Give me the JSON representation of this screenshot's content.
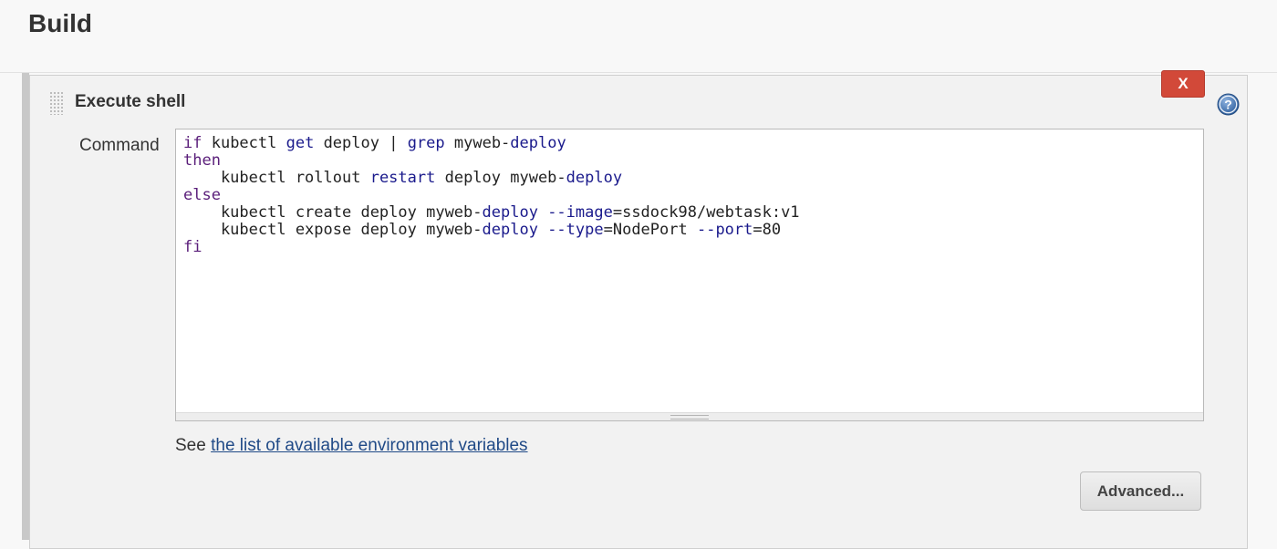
{
  "section": {
    "title": "Build"
  },
  "step": {
    "title": "Execute shell",
    "delete_label": "X",
    "help_icon": "question-circle-icon",
    "drag_icon": "drag-handle-icon"
  },
  "command": {
    "label": "Command",
    "lines": [
      "if kubectl get deploy | grep myweb-deploy",
      "then",
      "    kubectl rollout restart deploy myweb-deploy",
      "else",
      "    kubectl create deploy myweb-deploy --image=ssdock98/webtask:v1",
      "    kubectl expose deploy myweb-deploy --type=NodePort --port=80",
      "fi"
    ]
  },
  "env": {
    "prefix": "See",
    "link_text": "the list of available environment variables"
  },
  "advanced": {
    "label": "Advanced..."
  },
  "colors": {
    "delete_button": "#d24939",
    "link": "#204a87",
    "keyword": "#5a1e7a",
    "builtin": "#1a1a8c"
  }
}
